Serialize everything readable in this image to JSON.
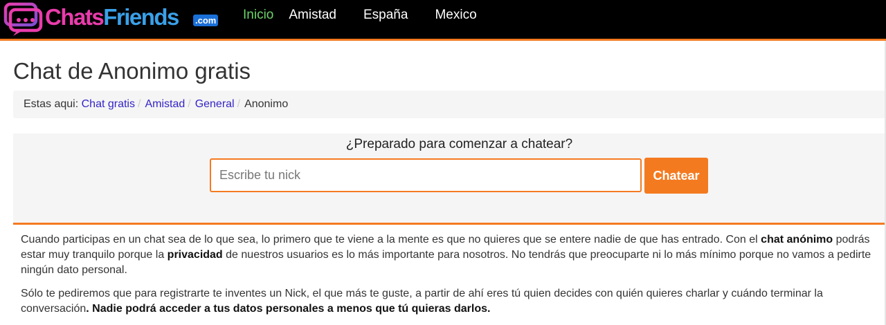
{
  "brand": {
    "name_part1": "Chats",
    "name_part2": "Friends",
    "tld": ".com",
    "colors": {
      "pink": "#e93cac",
      "blue": "#3aa0e8",
      "accent": "#f47a20"
    }
  },
  "nav": {
    "items": [
      {
        "label": "Inicio",
        "active": true
      },
      {
        "label": "Amistad"
      },
      {
        "label": "España"
      },
      {
        "label": "Mexico"
      }
    ]
  },
  "page": {
    "title": "Chat de Anonimo gratis"
  },
  "breadcrumb": {
    "prefix": "Estas aqui:",
    "items": [
      {
        "label": "Chat gratis"
      },
      {
        "label": "Amistad"
      },
      {
        "label": "General"
      }
    ],
    "separator": "/",
    "current": "Anonimo"
  },
  "chat": {
    "question": "¿Preparado para comenzar a chatear?",
    "nick_placeholder": "Escribe tu nick",
    "nick_value": "",
    "button_label": "Chatear"
  },
  "content": {
    "p1": {
      "t1": "Cuando participas en un chat sea de lo que sea, lo primero que te viene a la mente es que no quieres que se entere nadie de que has entrado. Con el ",
      "b1": "chat anónimo",
      "t2": " podrás estar muy tranquilo porque la ",
      "b2": "privacidad",
      "t3": " de nuestros usuarios es lo más importante para nosotros. No tendrás que preocuparte ni lo más mínimo porque no vamos a pedirte ningún dato personal."
    },
    "p2": {
      "t1": "Sólo te pediremos que para registrarte te inventes un Nick, el que más te guste, a partir de ahí eres tú quien decides con quién quieres charlar y cuándo terminar la conversación",
      "b1": ". Nadie podrá acceder a tus datos personales a menos que tú quieras darlos."
    }
  }
}
